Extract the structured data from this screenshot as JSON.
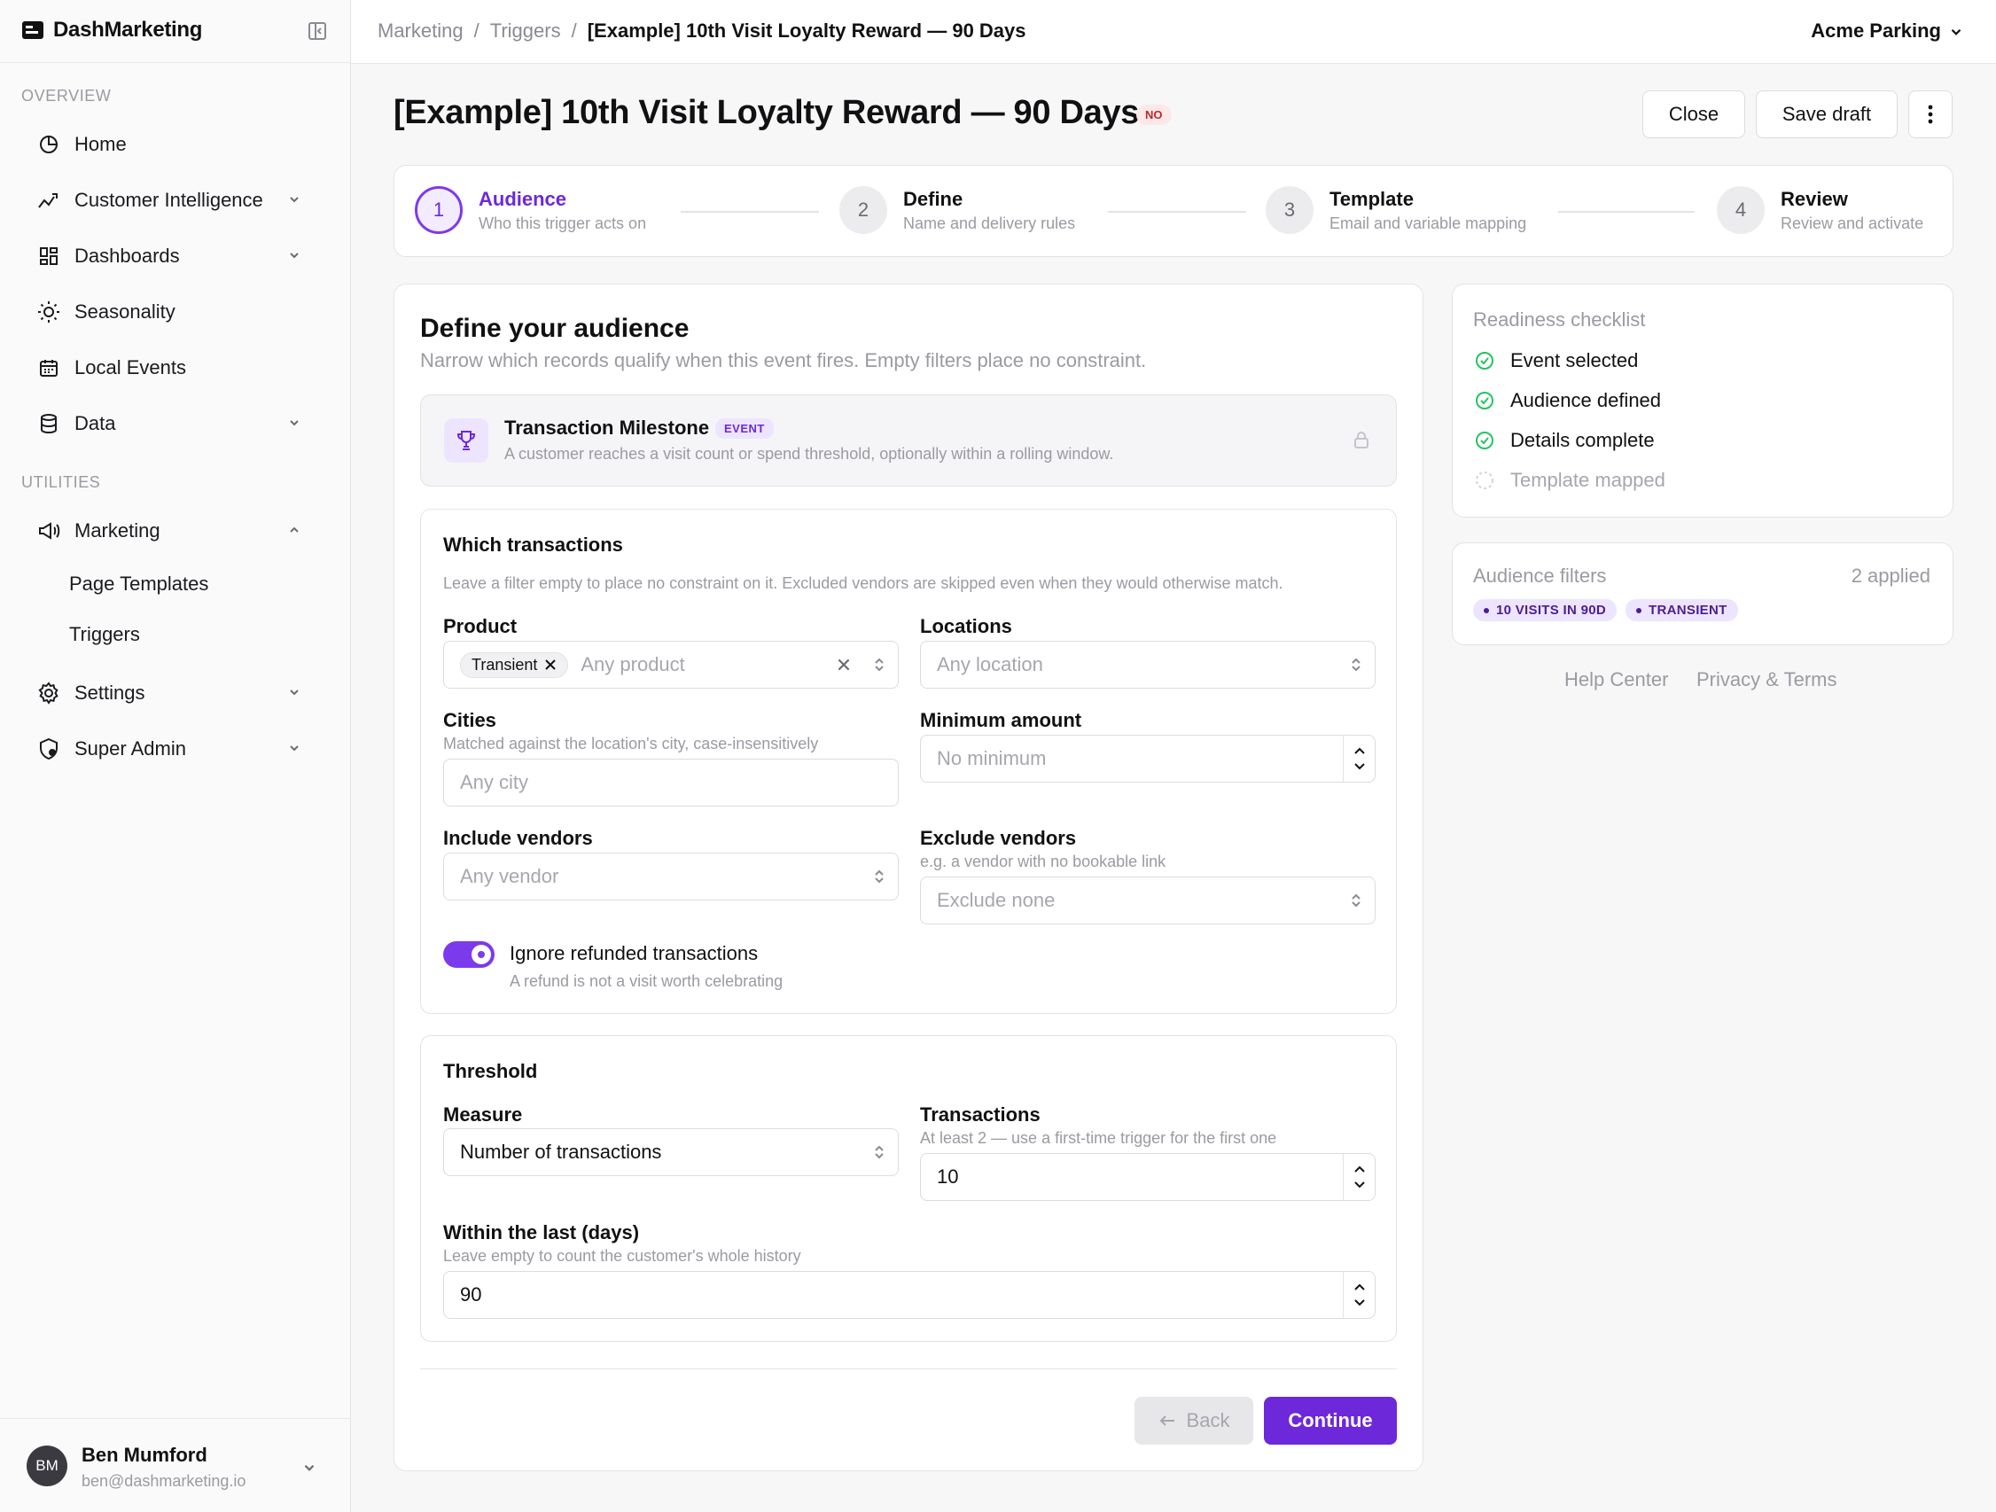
{
  "app": {
    "name": "DashMarketing"
  },
  "sidebar": {
    "overview_label": "OVERVIEW",
    "utilities_label": "UTILITIES",
    "items": [
      {
        "label": "Home",
        "icon": "chart-pie-icon"
      },
      {
        "label": "Customer Intelligence",
        "icon": "trend-icon"
      },
      {
        "label": "Dashboards",
        "icon": "dashboard-icon"
      },
      {
        "label": "Seasonality",
        "icon": "sun-icon"
      },
      {
        "label": "Local Events",
        "icon": "calendar-icon"
      },
      {
        "label": "Data",
        "icon": "database-icon"
      },
      {
        "label": "Marketing",
        "icon": "megaphone-icon"
      },
      {
        "label": "Settings",
        "icon": "gear-icon"
      },
      {
        "label": "Super Admin",
        "icon": "shield-icon"
      }
    ],
    "marketing_sub": [
      "Page Templates",
      "Triggers"
    ]
  },
  "user": {
    "initials": "BM",
    "name": "Ben Mumford",
    "email": "ben@dashmarketing.io"
  },
  "topbar": {
    "breadcrumbs": [
      "Marketing",
      "Triggers",
      "[Example] 10th Visit Loyalty Reward — 90 Days"
    ],
    "separator": "/",
    "org": "Acme Parking"
  },
  "page": {
    "title": "[Example] 10th Visit Loyalty Reward — 90 Days",
    "status_badge": "NO",
    "close_label": "Close",
    "save_label": "Save draft"
  },
  "steps": [
    {
      "num": "1",
      "title": "Audience",
      "desc": "Who this trigger acts on",
      "active": true
    },
    {
      "num": "2",
      "title": "Define",
      "desc": "Name and delivery rules"
    },
    {
      "num": "3",
      "title": "Template",
      "desc": "Email and variable mapping"
    },
    {
      "num": "4",
      "title": "Review",
      "desc": "Review and activate"
    }
  ],
  "audience": {
    "title": "Define your audience",
    "subtitle": "Narrow which records qualify when this event fires. Empty filters place no constraint.",
    "event": {
      "title": "Transaction Milestone",
      "badge": "EVENT",
      "desc": "A customer reaches a visit count or spend threshold, optionally within a rolling window."
    }
  },
  "transactions": {
    "title": "Which transactions",
    "hint": "Leave a filter empty to place no constraint on it. Excluded vendors are skipped even when they would otherwise match.",
    "product_label": "Product",
    "product_chip": "Transient",
    "product_placeholder": "Any product",
    "locations_label": "Locations",
    "locations_placeholder": "Any location",
    "cities_label": "Cities",
    "cities_hint": "Matched against the location's city, case-insensitively",
    "cities_placeholder": "Any city",
    "min_amount_label": "Minimum amount",
    "min_amount_placeholder": "No minimum",
    "include_vendors_label": "Include vendors",
    "include_vendors_placeholder": "Any vendor",
    "exclude_vendors_label": "Exclude vendors",
    "exclude_vendors_hint": "e.g. a vendor with no bookable link",
    "exclude_vendors_placeholder": "Exclude none",
    "refund_toggle_label": "Ignore refunded transactions",
    "refund_toggle_hint": "A refund is not a visit worth celebrating",
    "refund_toggle_on": true
  },
  "threshold": {
    "title": "Threshold",
    "measure_label": "Measure",
    "measure_value": "Number of transactions",
    "transactions_label": "Transactions",
    "transactions_hint": "At least 2 — use a first-time trigger for the first one",
    "transactions_value": "10",
    "window_label": "Within the last (days)",
    "window_hint": "Leave empty to count the customer's whole history",
    "window_value": "90"
  },
  "footer": {
    "back_label": "Back",
    "continue_label": "Continue"
  },
  "readiness": {
    "title": "Readiness checklist",
    "items": [
      {
        "label": "Event selected",
        "done": true
      },
      {
        "label": "Audience defined",
        "done": true
      },
      {
        "label": "Details complete",
        "done": true
      },
      {
        "label": "Template mapped",
        "done": false
      }
    ]
  },
  "filters": {
    "title": "Audience filters",
    "count": "2 applied",
    "pills": [
      "10 VISITS IN 90D",
      "TRANSIENT"
    ]
  },
  "links": {
    "help": "Help Center",
    "privacy": "Privacy & Terms"
  },
  "colors": {
    "accent": "#6d28d9",
    "success": "#22c55e",
    "danger": "#c0262d"
  }
}
